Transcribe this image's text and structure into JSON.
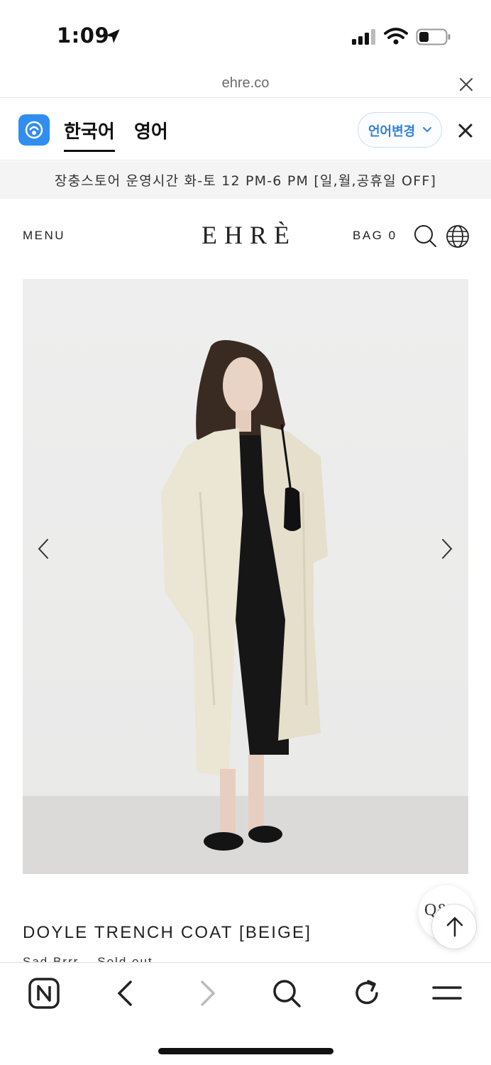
{
  "status_bar": {
    "time": "1:09"
  },
  "url_bar": {
    "domain": "ehre.co"
  },
  "translate_bar": {
    "tab_korean": "한국어",
    "tab_english": "영어",
    "change_language_label": "언어변경"
  },
  "announcement": {
    "text": "장충스토어 운영시간 화-토 12 PM-6 PM [일,월,공휴일 OFF]"
  },
  "site_header": {
    "menu_label": "MENU",
    "logo": "EHRÈ",
    "bag_label": "BAG 0"
  },
  "product": {
    "title": "DOYLE TRENCH COAT [BEIGE]",
    "subtitle": "Sad Brrr... Sold out",
    "chat_label": "Q&"
  },
  "colors": {
    "accent_blue": "#2f8ef0",
    "coat_beige": "#ece6d6"
  },
  "icons": {
    "header": [
      "search-icon",
      "globe-icon"
    ],
    "carousel": [
      "chevron-left-icon",
      "chevron-right-icon"
    ],
    "toolbar": [
      "naver-home-icon",
      "back-icon",
      "forward-icon",
      "search-icon",
      "reload-icon",
      "menu-icon"
    ]
  }
}
